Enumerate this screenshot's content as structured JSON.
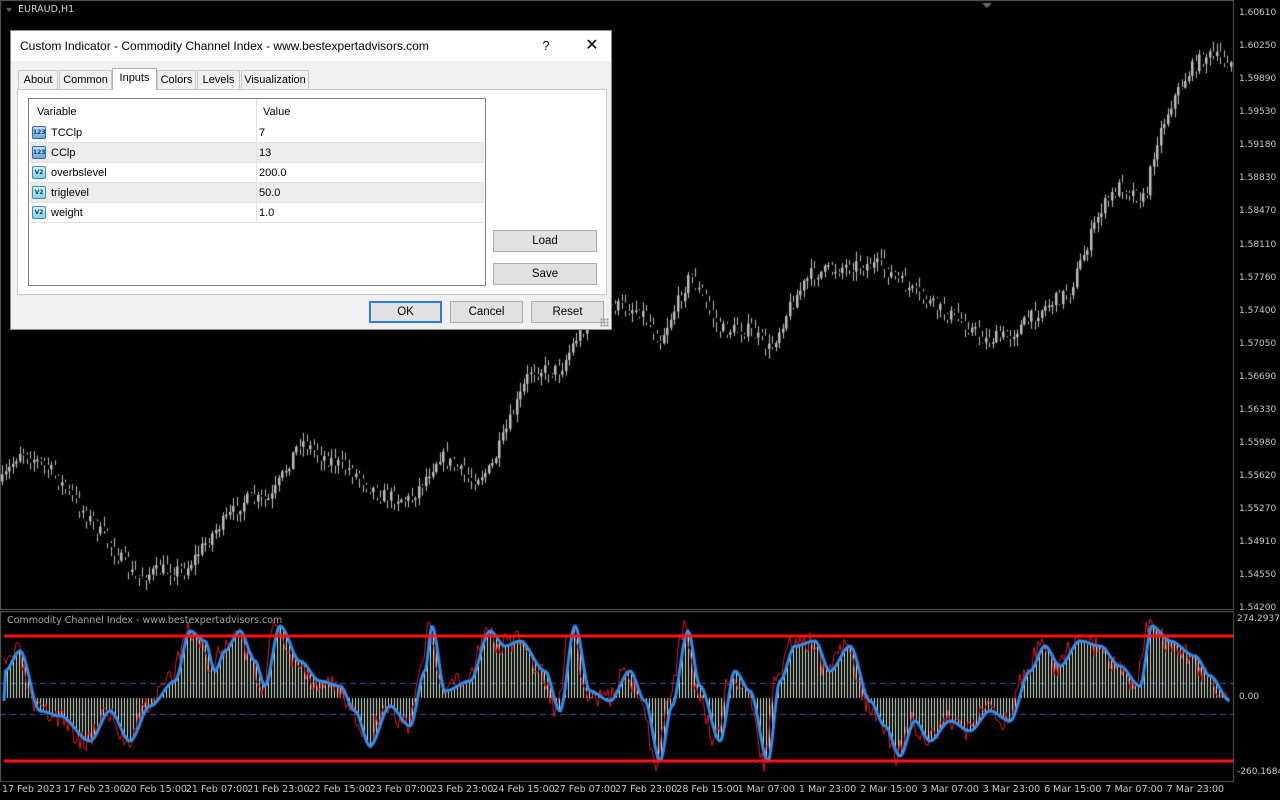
{
  "chart": {
    "symbol": "EURAUD,H1",
    "price_labels": [
      "1.60610",
      "1.60250",
      "1.59890",
      "1.59530",
      "1.59180",
      "1.58830",
      "1.58470",
      "1.58110",
      "1.57760",
      "1.57400",
      "1.57050",
      "1.56690",
      "1.56330",
      "1.55980",
      "1.55620",
      "1.55270",
      "1.54910",
      "1.54550",
      "1.54200"
    ],
    "indicator_title": "Commodity Channel Index - www.bestexpertadvisors.com",
    "indicator_labels": [
      "274.2937",
      "0.00",
      "-260.1684"
    ],
    "time_labels": [
      "17 Feb 2023",
      "17 Feb 23:00",
      "20 Feb 15:00",
      "21 Feb 07:00",
      "21 Feb 23:00",
      "22 Feb 15:00",
      "23 Feb 07:00",
      "23 Feb 23:00",
      "24 Feb 15:00",
      "27 Feb 07:00",
      "27 Feb 23:00",
      "28 Feb 15:00",
      "1 Mar 07:00",
      "1 Mar 23:00",
      "2 Mar 15:00",
      "3 Mar 07:00",
      "3 Mar 23:00",
      "6 Mar 15:00",
      "7 Mar 07:00",
      "7 Mar 23:00"
    ],
    "colors": {
      "background": "#000000",
      "candles": "#bdbdbd",
      "cci_line": "#2f8ff0",
      "trigger_line": "#e02020",
      "level_lines": "#ff1414",
      "histogram": "#d9e8cf",
      "dashed_levels": "#2f5aa8"
    }
  },
  "dialog": {
    "title": "Custom Indicator - Commodity Channel Index - www.bestexpertadvisors.com",
    "help": "?",
    "close": "✕",
    "tabs": [
      "About",
      "Common",
      "Inputs",
      "Colors",
      "Levels",
      "Visualization"
    ],
    "active_tab": "Inputs",
    "columns": {
      "variable": "Variable",
      "value": "Value"
    },
    "inputs": [
      {
        "name": "TCClp",
        "value": "7",
        "icon": "int-icon",
        "icon_text": "123"
      },
      {
        "name": "CClp",
        "value": "13",
        "icon": "int-icon",
        "icon_text": "123"
      },
      {
        "name": "overbslevel",
        "value": "200.0",
        "icon": "double-icon",
        "icon_text": "V2"
      },
      {
        "name": "triglevel",
        "value": "50.0",
        "icon": "double-icon",
        "icon_text": "V2"
      },
      {
        "name": "weight",
        "value": "1.0",
        "icon": "double-icon",
        "icon_text": "V2"
      }
    ],
    "buttons": {
      "load": "Load",
      "save": "Save",
      "ok": "OK",
      "cancel": "Cancel",
      "reset": "Reset"
    }
  }
}
